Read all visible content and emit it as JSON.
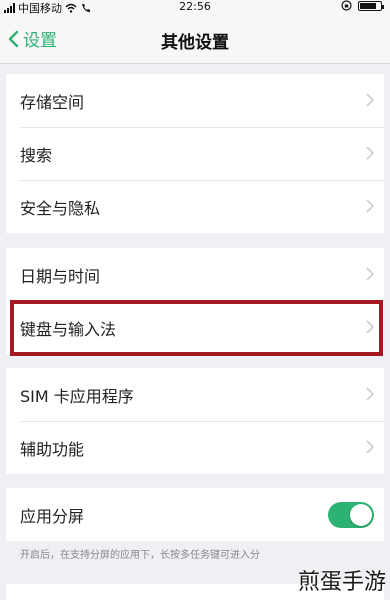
{
  "status_bar": {
    "carrier": "中国移动",
    "time": "22:56"
  },
  "nav": {
    "back_label": "设置",
    "title": "其他设置"
  },
  "groups": [
    {
      "items": [
        "存储空间",
        "搜索",
        "安全与隐私"
      ]
    },
    {
      "items": [
        "日期与时间",
        "键盘与输入法"
      ]
    },
    {
      "items": [
        "SIM 卡应用程序",
        "辅助功能"
      ]
    },
    {
      "items": [
        "应用分屏"
      ]
    }
  ],
  "split_screen": {
    "enabled": true,
    "hint": "开启后，在支持分屏的应用下，长按多任务键可进入分"
  },
  "highlighted_item": "键盘与输入法",
  "watermark": "煎蛋手游",
  "colors": {
    "accent": "#2cb373",
    "highlight_border": "#a31821",
    "background": "#efeff4"
  }
}
